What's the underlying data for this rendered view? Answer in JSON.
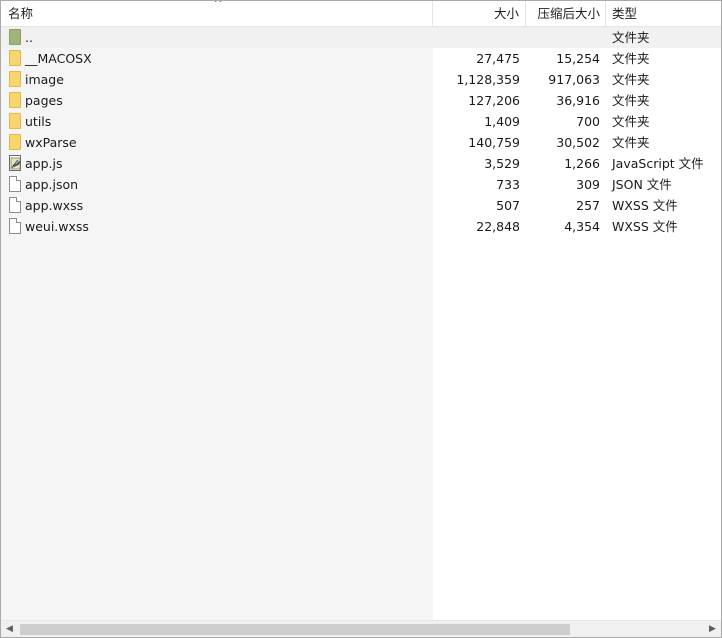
{
  "header": {
    "name": "名称",
    "size": "大小",
    "packed": "压缩后大小",
    "type": "类型"
  },
  "rows": [
    {
      "name": "..",
      "size": "",
      "packed": "",
      "type": "文件夹",
      "icon": "parent-folder-icon"
    },
    {
      "name": "__MACOSX",
      "size": "27,475",
      "packed": "15,254",
      "type": "文件夹",
      "icon": "folder-icon"
    },
    {
      "name": "image",
      "size": "1,128,359",
      "packed": "917,063",
      "type": "文件夹",
      "icon": "folder-icon"
    },
    {
      "name": "pages",
      "size": "127,206",
      "packed": "36,916",
      "type": "文件夹",
      "icon": "folder-icon"
    },
    {
      "name": "utils",
      "size": "1,409",
      "packed": "700",
      "type": "文件夹",
      "icon": "folder-icon"
    },
    {
      "name": "wxParse",
      "size": "140,759",
      "packed": "30,502",
      "type": "文件夹",
      "icon": "folder-icon"
    },
    {
      "name": "app.js",
      "size": "3,529",
      "packed": "1,266",
      "type": "JavaScript 文件",
      "icon": "javascript-file-icon"
    },
    {
      "name": "app.json",
      "size": "733",
      "packed": "309",
      "type": "JSON 文件",
      "icon": "file-icon"
    },
    {
      "name": "app.wxss",
      "size": "507",
      "packed": "257",
      "type": "WXSS 文件",
      "icon": "file-icon"
    },
    {
      "name": "weui.wxss",
      "size": "22,848",
      "packed": "4,354",
      "type": "WXSS 文件",
      "icon": "file-icon"
    }
  ],
  "colors": {
    "name_column_bg": "#f5f5f5",
    "folder": "#f7d571",
    "parent_folder": "#9fb47a",
    "scroll_thumb": "#cdcdcd"
  }
}
